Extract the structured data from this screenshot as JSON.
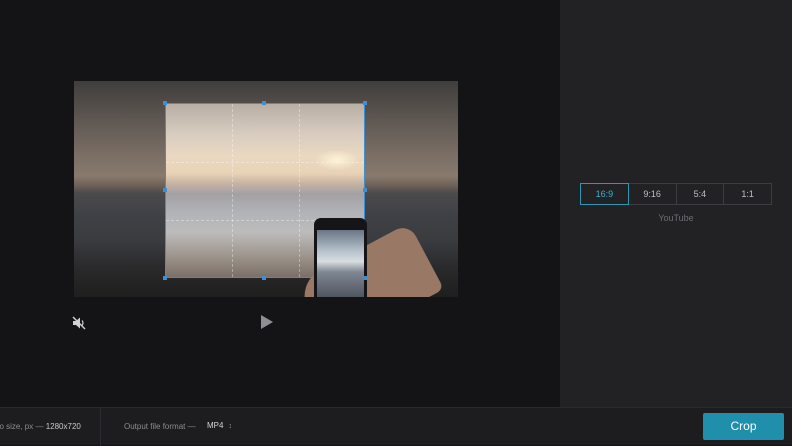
{
  "editor": {
    "video": {
      "muted": true,
      "state": "paused"
    },
    "icons": {
      "mute": "speaker-muted-icon",
      "play": "play-icon"
    }
  },
  "sidebar": {
    "aspect_ratios": [
      {
        "label": "16:9",
        "active": true
      },
      {
        "label": "9:16",
        "active": false
      },
      {
        "label": "5:4",
        "active": false
      },
      {
        "label": "1:1",
        "active": false
      }
    ],
    "preset_caption": "YouTube"
  },
  "bottom_bar": {
    "video_size_label": "eo size, px —",
    "video_size_value": "1280x720",
    "format_label": "Output file format —",
    "format_value": "MP4",
    "crop_label": "Crop"
  },
  "colors": {
    "accent": "#1f8fab",
    "selection": "#3e8ed0"
  }
}
